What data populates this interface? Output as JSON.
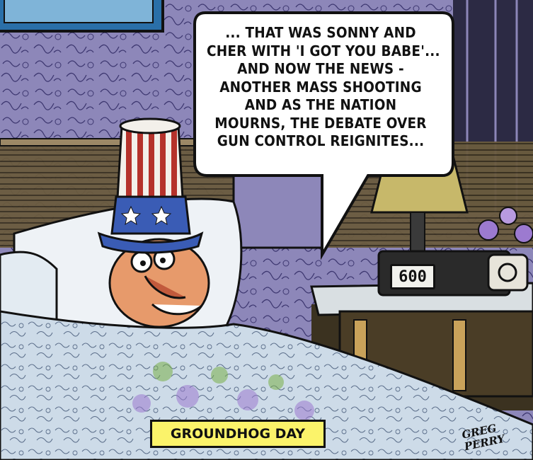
{
  "speech_bubble": {
    "lines": [
      "... THAT WAS SONNY AND",
      "CHER WITH 'I GOT YOU BABE'...",
      "AND NOW THE NEWS -",
      "ANOTHER MASS SHOOTING",
      "AND AS THE NATION",
      "MOURNS, THE DEBATE OVER",
      "GUN CONTROL REIGNITES..."
    ]
  },
  "clock": {
    "time": "600"
  },
  "caption": {
    "text": "GROUNDHOG DAY"
  },
  "signature": {
    "lines": [
      "GREG",
      "PERRY"
    ]
  },
  "colors": {
    "wallpaper": "#8c86b8",
    "bedspread": "#c9d8e6",
    "pillow": "#eef2f6",
    "hat_band": "#3a5cb5",
    "hat_stripe_red": "#b5322b",
    "skin": "#e79a6b",
    "caption_bg": "#fbf36a",
    "lamp_shade": "#c7b86a",
    "nightstand": "#c9a25a"
  }
}
